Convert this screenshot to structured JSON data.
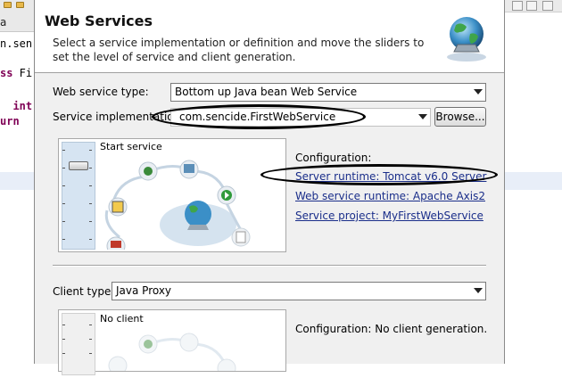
{
  "background_editor": {
    "tab_text": "a",
    "code_lines": [
      {
        "kind": "plain",
        "text": "n.sen"
      },
      {
        "kind": "kw_plain",
        "kw": "ss",
        "text": " Fi"
      },
      {
        "kind": "kw_plain",
        "kw": "",
        "text": "  int"
      },
      {
        "kind": "kw",
        "kw": "urn",
        "text": ""
      }
    ]
  },
  "dialog": {
    "title": "Web Services",
    "description": "Select a service implementation or definition and move the sliders to set the level of service and client generation.",
    "service": {
      "type_label": "Web service type:",
      "type_value": "Bottom up Java bean Web Service",
      "impl_label": "Service implementation:",
      "impl_value": "com.sencide.FirstWebService",
      "browse_label": "Browse...",
      "slider_stage": "Start service",
      "configuration_label": "Configuration:",
      "links": [
        "Server runtime: Tomcat v6.0 Server",
        "Web service runtime: Apache Axis2",
        "Service project: MyFirstWebService"
      ]
    },
    "client": {
      "type_label": "Client type:",
      "type_value": "Java Proxy",
      "slider_stage": "No client",
      "configuration_text": "Configuration: No client generation."
    }
  },
  "colors": {
    "link": "#1a2e8a",
    "dialog_bg": "#f0f0f0",
    "slider_track": "#d6e4f2",
    "annotation": "#000000"
  },
  "icons": [
    "web-services-globe-icon",
    "chevron-down-icon",
    "service-stage-diagram"
  ]
}
